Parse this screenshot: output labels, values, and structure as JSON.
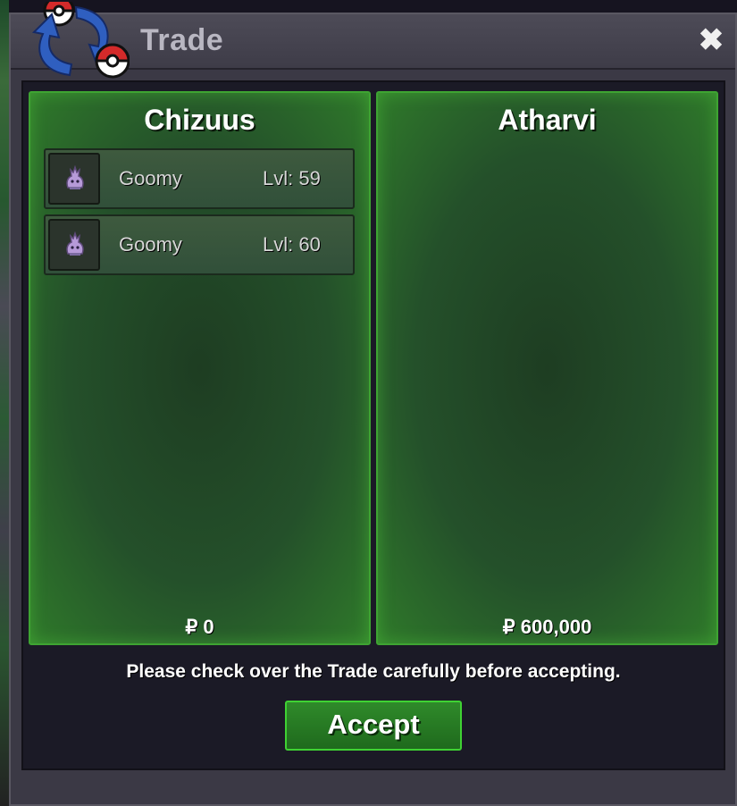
{
  "window": {
    "title": "Trade",
    "close_label": "✖"
  },
  "left_player": {
    "name": "Chizuus",
    "items": [
      {
        "pokemon": "Goomy",
        "level": "Lvl: 59",
        "icon": "goomy-icon"
      },
      {
        "pokemon": "Goomy",
        "level": "Lvl: 60",
        "icon": "goomy-icon"
      }
    ],
    "money": "₽ 0"
  },
  "right_player": {
    "name": "Atharvi",
    "items": [],
    "money": "₽ 600,000"
  },
  "notice": "Please check over the Trade carefully before accepting.",
  "accept_label": "Accept",
  "colors": {
    "panel_border": "#3ea432",
    "accept_border": "#3fd233"
  }
}
